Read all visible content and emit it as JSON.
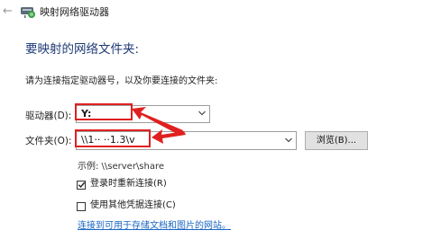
{
  "window": {
    "title": "映射网络驱动器",
    "back_icon": "back-arrow-icon",
    "app_icon": "network-drive-icon"
  },
  "main": {
    "heading": "要映射的网络文件夹:",
    "instruction": "请为连接指定驱动器号，以及你要连接的文件夹:",
    "drive": {
      "label": "驱动器(D):",
      "value": "Y:"
    },
    "folder": {
      "label": "文件夹(O):",
      "value": "\\\\1·· ··1.3\\v",
      "browse_label": "浏览(B)..."
    },
    "example": "示例: \\\\server\\share",
    "options": [
      {
        "label": "登录时重新连接(R)",
        "checked": true
      },
      {
        "label": "使用其他凭据连接(C)",
        "checked": false
      }
    ],
    "link": "连接到可用于存储文档和图片的网站。"
  },
  "colors": {
    "heading": "#1f3a75",
    "link": "#1a66c2",
    "annotation": "#e02020",
    "button_bg": "#e1e1e1"
  }
}
